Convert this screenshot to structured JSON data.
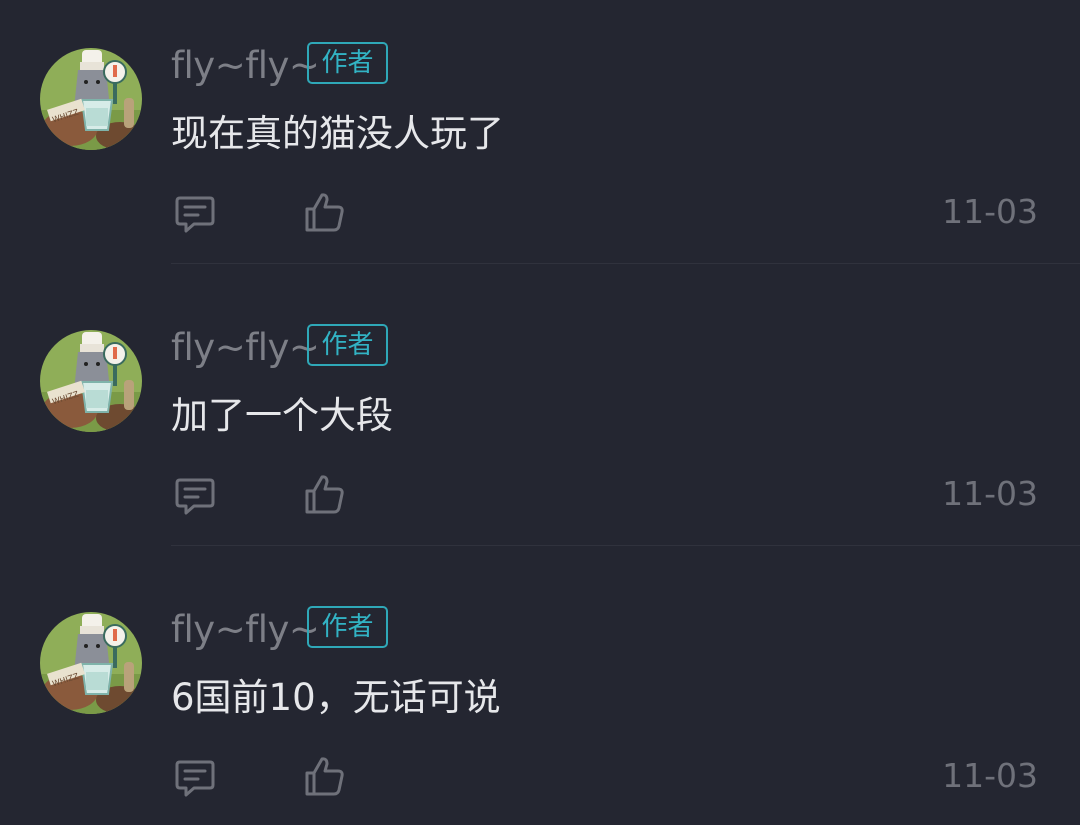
{
  "colors": {
    "background": "#242631",
    "username": "#7d7f87",
    "badge_accent": "#32b3c4",
    "content_text": "#e6e7ea",
    "meta_text": "#6f717a"
  },
  "comments": [
    {
      "username": "fly~fly~",
      "badge": "作者",
      "text": "现在真的猫没人玩了",
      "date": "11-03",
      "avatar_icon": "cat-cook-avatar"
    },
    {
      "username": "fly~fly~",
      "badge": "作者",
      "text": "加了一个大段",
      "date": "11-03",
      "avatar_icon": "cat-cook-avatar"
    },
    {
      "username": "fly~fly~",
      "badge": "作者",
      "text": "6国前10，无话可说",
      "date": "11-03",
      "avatar_icon": "cat-cook-avatar"
    }
  ]
}
